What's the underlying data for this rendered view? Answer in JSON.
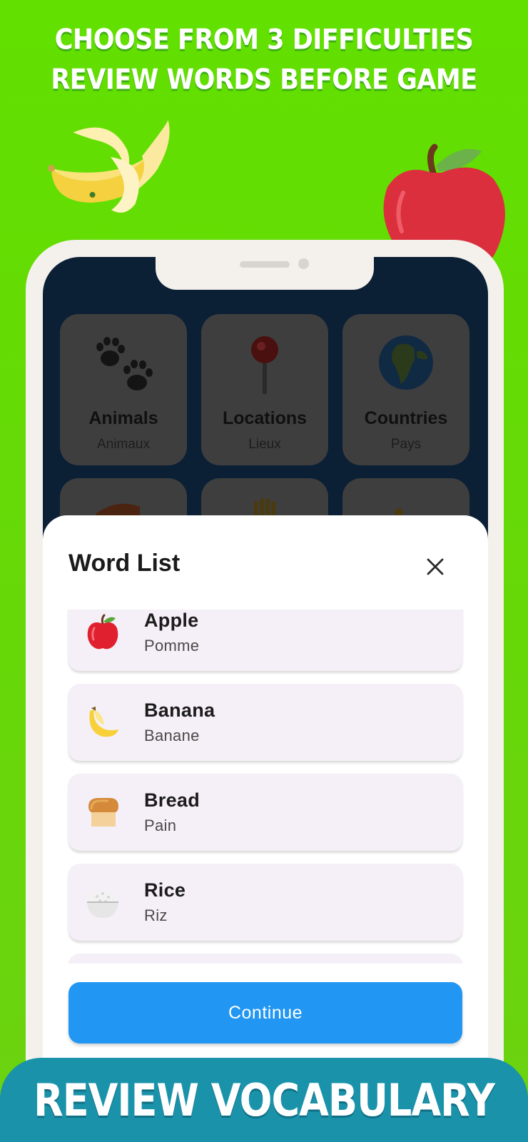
{
  "promo": {
    "line1": "CHOOSE FROM 3 DIFFICULTIES",
    "line2": "REVIEW WORDS BEFORE GAME",
    "banner": "REVIEW VOCABULARY"
  },
  "categories": [
    {
      "title": "Animals",
      "subtitle": "Animaux",
      "icon": "paw-icon"
    },
    {
      "title": "Locations",
      "subtitle": "Lieux",
      "icon": "pushpin-icon"
    },
    {
      "title": "Countries",
      "subtitle": "Pays",
      "icon": "globe-icon"
    }
  ],
  "word_list": {
    "title": "Word List",
    "close_icon": "close-icon",
    "items": [
      {
        "en": "Apple",
        "fr": "Pomme",
        "icon": "apple-icon"
      },
      {
        "en": "Banana",
        "fr": "Banane",
        "icon": "banana-icon"
      },
      {
        "en": "Bread",
        "fr": "Pain",
        "icon": "bread-icon"
      },
      {
        "en": "Rice",
        "fr": "Riz",
        "icon": "rice-bowl-icon"
      }
    ],
    "continue_label": "Continue"
  },
  "colors": {
    "background": "#62e000",
    "screen": "#0b1f35",
    "button": "#2196f3",
    "banner": "#1a93aa",
    "list_item": "#f5eff7"
  }
}
